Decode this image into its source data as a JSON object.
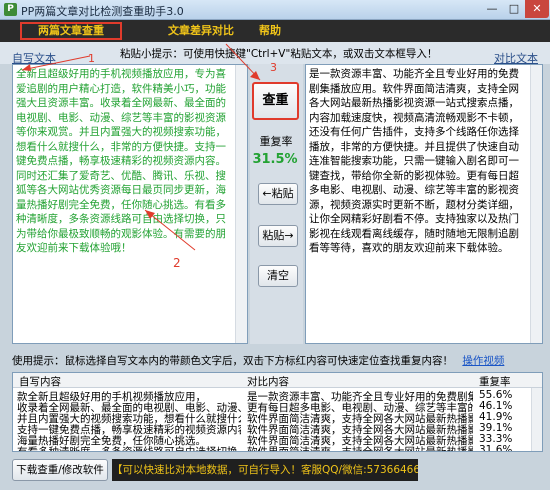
{
  "window": {
    "title": "PP两篇文章对比检测查重助手3.0",
    "min_glyph": "—",
    "max_glyph": "□",
    "close_glyph": "✕"
  },
  "tabs": [
    {
      "label": "两篇文章查重"
    },
    {
      "label": "文章差异对比"
    },
    {
      "label": "帮助"
    }
  ],
  "hint_bar": {
    "left_label": "自写文本",
    "tip": "粘贴小提示：可使用快捷键\"Ctrl+V\"粘贴文本，或双击文本框导入！",
    "right_label": "对比文本"
  },
  "left_text": "全新且超级好用的手机视频播放应用，专为喜爱追剧的用户精心打造，软件精美小巧，功能强大且资源丰富。收录着全网最新、最全面的电视剧、电影、动漫、综艺等丰富的影视资源等你来观赏。并且内置强大的视频搜索功能，想看什么就搜什么，非常的方便快捷。支持一键免费点播，畅享极速精彩的视频资源内容。同时还汇集了爱奇艺、优酷、腾讯、乐视、搜狐等各大网站优秀资源每日最页同步更新，海量热播好剧完全免费，任你随心挑选。有看多种清晰度，多条资源线路可自由选择切换，只为带给你最极致顺畅的观影体验。有需要的朋友欢迎前来下载体验哦！",
  "right_text": "是一款资源丰富、功能齐全且专业好用的免费剧集播放应用。软件界面简洁清爽，支持全网各大网站最新热播影视资源一站式搜索点播，内容加载速度快，视频高清流畅观影不卡顿，还没有任何广告插件，支持多个线路任你选择播放，非常的方便快捷。并且提供了快速自动连准智能搜索功能，只需一键输入剧名即可一键查找，带给你全新的影视体验。更有每日超多电影、电视剧、动漫、综艺等丰富的影视资源，视频资源实时更新不断，题材分类详细，让你全网精彩好剧看不停。支持独家以及热门影视在线观看离线缓存，随时随地无限制追剧看等等待，喜欢的朋友欢迎前来下载体验。",
  "buttons": {
    "check": "查重",
    "paste_left": "←粘贴",
    "paste_right": "粘贴→",
    "clear": "清空",
    "download": "下载查重/修改软件"
  },
  "result": {
    "label": "重复率",
    "value": "31.5%",
    "value_color": "#23a233"
  },
  "annotations": [
    "1",
    "2",
    "3"
  ],
  "usage_tip": {
    "text": "使用提示：鼠标选择自写文本内的带颜色文字后，双击下方标红内容可快速定位查找重复内容！",
    "link": "操作视频"
  },
  "table": {
    "columns": [
      "自写内容",
      "对比内容",
      "重复率"
    ],
    "rows": [
      [
        "款全新且超级好用的手机视频播放应用，",
        "是一款资源丰富、功能齐全且专业好用的免费剧集播放应用。",
        "55.6%"
      ],
      [
        "收录着全网最新、最全面的电视剧、电影、动漫、综",
        "更有每日超多电影、电视剧、动漫、综艺等丰富的影视资源。",
        "46.1%"
      ],
      [
        "并且内置强大的视频搜索功能，想看什么就搜什么，",
        "软件界面简洁清爽，支持全网各大网站最新热播影视",
        "41.9%"
      ],
      [
        "支持一键免费点播，畅享极速精彩的视频资源内容。",
        "软件界面简洁清爽，支持全网各大网站最新热播影视",
        "39.1%"
      ],
      [
        "海量热播好剧完全免费，任你随心挑选。",
        "软件界面简洁清爽，支持全网各大网站最新热播影视",
        "33.3%"
      ],
      [
        "有看多种清晰度，多条资源线路可自由选择切换，",
        "软件界面简洁清爽，支持全网各大网站最新热播影视",
        "31.6%"
      ]
    ]
  },
  "footer": {
    "contact": "【可以快速比对本地数据，可自行导入！客服QQ/微信:573664660】"
  },
  "colors": {
    "accent_red": "#e03b2c",
    "tab_gold": "#f0c419",
    "text_green": "#23a233",
    "link_blue": "#1a55c6"
  }
}
